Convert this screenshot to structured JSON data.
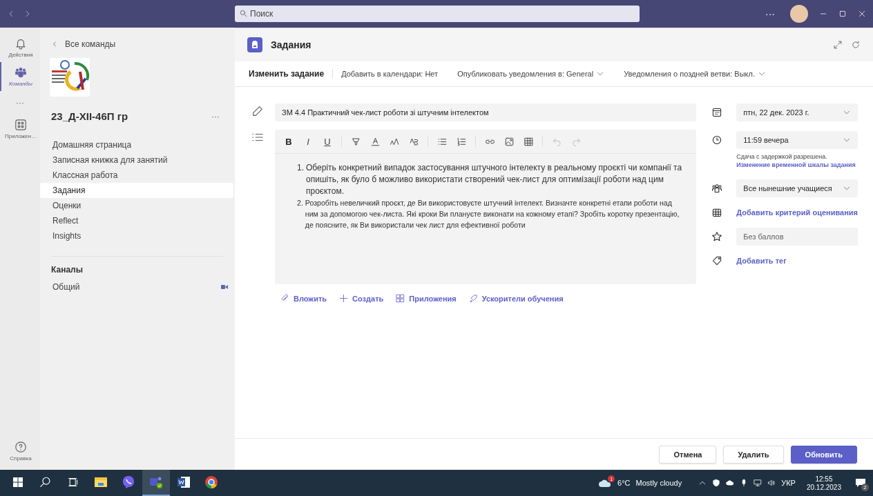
{
  "title_bar": {
    "search": {
      "placeholder": "Поиск"
    },
    "more": "···"
  },
  "app_rail": {
    "items": [
      {
        "label": "Действия",
        "kind": "bell",
        "selected": false
      },
      {
        "label": "Команды",
        "kind": "teams",
        "selected": true
      },
      {
        "label": "Приложен…",
        "kind": "apps",
        "selected": false
      }
    ],
    "more": "···",
    "help": "Справка"
  },
  "team_panel": {
    "back_link": "Все команды",
    "team_name": "23_Д-XII-46П гр",
    "more": "···",
    "nav": [
      {
        "label": "Домашняя страница",
        "selected": false
      },
      {
        "label": "Записная книжка для занятий",
        "selected": false
      },
      {
        "label": "Классная работа",
        "selected": false
      },
      {
        "label": "Задания",
        "selected": true
      },
      {
        "label": "Оценки",
        "selected": false
      },
      {
        "label": "Reflect",
        "selected": false
      },
      {
        "label": "Insights",
        "selected": false
      }
    ],
    "channels_heading": "Каналы",
    "channels": [
      {
        "name": "Общий",
        "kind": "meeting"
      }
    ]
  },
  "app_header": {
    "title": "Задания"
  },
  "command_bar": {
    "title": "Изменить задание",
    "items": [
      {
        "label": "Добавить в календари: Нет",
        "kind": "toggle"
      },
      {
        "label": "Опубликовать уведомления в: General",
        "kind": "dropdown"
      },
      {
        "label": "Уведомления о поздней ветви: Выкл.",
        "kind": "dropdown"
      }
    ]
  },
  "form": {
    "title": "ЗМ 4.4 Практичний чек-лист роботи зі штучним інтелектом",
    "format_buttons": [
      "B",
      "I",
      "U"
    ],
    "instructions": [
      {
        "number": "1.",
        "text": "Оберіть конкретний випадок застосування штучного інтелекту в реальному проєкті чи компанії та опишіть, як було б можливо використати створений чек-лист для оптимізації роботи над цим проєктом.",
        "kind": "large"
      },
      {
        "number": "2.",
        "text": "Розробіть невеличкий проєкт, де Ви використовуєте штучний інтелект. Визначте конкретні етапи роботи над ним за допомогою чек-листа. Які кроки Ви плануєте виконати на кожному етапі? Зробіть коротку презентацію, де поясните, як Ви використали чек лист для ефективної роботи",
        "kind": "small"
      }
    ],
    "actions": [
      {
        "label": "Вложить",
        "kind": "attach"
      },
      {
        "label": "Создать",
        "kind": "new"
      },
      {
        "label": "Приложения",
        "kind": "apps"
      },
      {
        "label": "Ускорители обучения",
        "kind": "accelerators"
      }
    ]
  },
  "details": {
    "due_date": "птн, 22 дек. 2023 г.",
    "due_time": "11:59 вечера",
    "late_note": "Сдача с задержкой разрешена.",
    "timeline_link": "Изменение временной шкалы задания",
    "assign_to": "Все нынешние учащиеся",
    "rubric_link": "Добавить критерий оценивания",
    "points": {
      "placeholder": "Без баллов"
    },
    "tag_link": "Добавить тег"
  },
  "footer": {
    "buttons": [
      {
        "label": "Отмена",
        "kind": "secondary"
      },
      {
        "label": "Удалить",
        "kind": "secondary"
      },
      {
        "label": "Обновить",
        "kind": "primary"
      }
    ]
  },
  "taskbar": {
    "apps": [
      {
        "kind": "explorer",
        "selected": false
      },
      {
        "kind": "viber",
        "selected": false
      },
      {
        "kind": "teams",
        "selected": true
      },
      {
        "kind": "word",
        "selected": false
      },
      {
        "kind": "chrome",
        "selected": false
      }
    ],
    "weather_badge": "1",
    "temperature": "6°C",
    "weather": "Mostly cloudy",
    "language": "УКР",
    "time": "12:55",
    "date": "20.12.2023",
    "notifications": "2"
  }
}
